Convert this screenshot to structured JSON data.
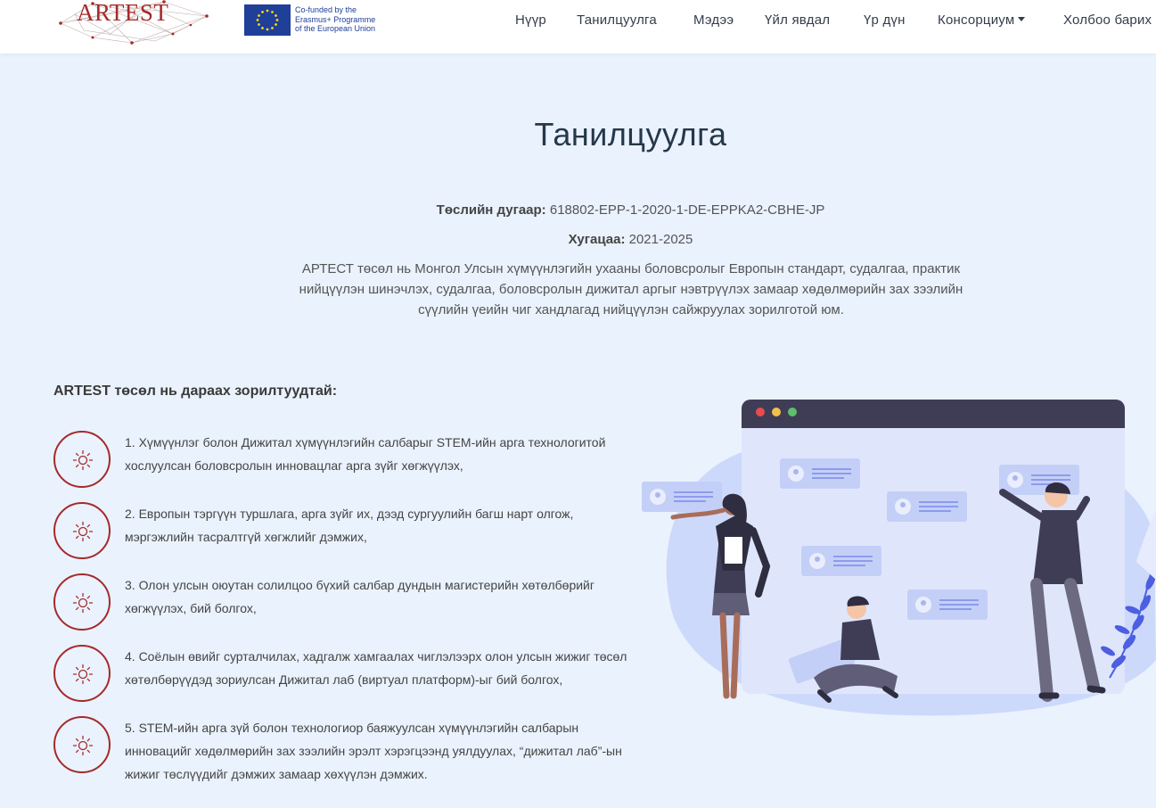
{
  "header": {
    "logo_text": "ARTEST",
    "eu_text": [
      "Co-funded by the",
      "Erasmus+ Programme",
      "of the European Union"
    ],
    "nav": [
      "Нүүр",
      "Танилцуулга",
      "Мэдээ",
      "Үйл явдал",
      "Үр дүн",
      "Консорциум",
      "Холбоо барих"
    ]
  },
  "page": {
    "title": "Танилцуулга",
    "project_label": "Төслийн дугаар:",
    "project_value": "618802-EPP-1-2020-1-DE-EPPKA2-CBHE-JP",
    "duration_label": "Хугацаа:",
    "duration_value": "2021-2025",
    "description": "АРТЕСТ төсөл нь Монгол Улсын хүмүүнлэгийн ухааны боловсролыг Европын стандарт, судалгаа, практик нийцүүлэн шинэчлэх, судалгаа, боловсролын дижитал аргыг нэвтрүүлэх замаар хөдөлмөрийн зах зээлийн сүүлийн үеийн чиг хандлагад нийцүүлэн сайжруулах зорилготой юм."
  },
  "goals": {
    "title": "ARTEST төсөл нь дараах зорилтуудтай:",
    "items": [
      "1. Хүмүүнлэг болон Дижитал хүмүүнлэгийн салбарыг STEM-ийн арга технологитой хослуулсан боловсролын инновацлаг арга зүйг хөгжүүлэх,",
      "2. Европын тэргүүн туршлага, арга зүйг их, дээд сургуулийн багш нарт олгож, мэргэжлийн тасралтгүй хөгжлийг дэмжих,",
      "3. Олон улсын оюутан солилцоо бүхий салбар дундын магистерийн хөтөлбөрийг хөгжүүлэх, бий болгох,",
      "4. Соёлын өвийг сурталчилах, хадгалж хамгаалах чиглэлээрх олон улсын жижиг төсөл хөтөлбөрүүдэд зориулсан Дижитал лаб (виртуал платформ)-ыг бий болгох,",
      "5. STEM-ийн арга зүй болон технологиор баяжуулсан хүмүүнлэгийн салбарын инновацийг хөдөлмөрийн зах зээлийн эрэлт хэрэгцээнд уялдуулах, “дижитал лаб”-ын жижиг төслүүдийг дэмжих замаар хөхүүлэн дэмжих."
    ]
  },
  "colors": {
    "accent": "#a52a2a",
    "background": "#eaf2fd",
    "title": "#25384a",
    "illustration_blue": "#6c7ce7"
  }
}
